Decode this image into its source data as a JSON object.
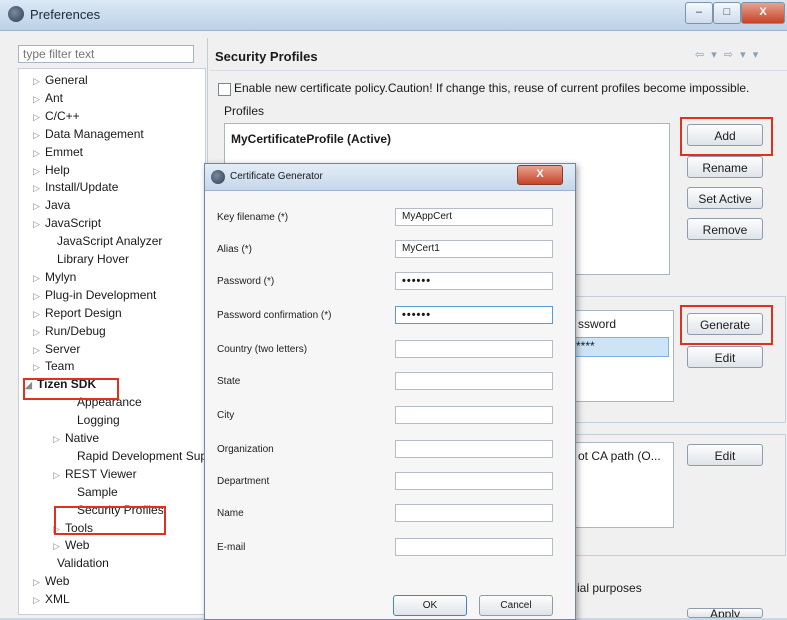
{
  "window": {
    "title": "Preferences",
    "min_label": "–",
    "max_label": "□",
    "close_label": "X"
  },
  "filter": {
    "placeholder": "type filter text"
  },
  "tree": [
    {
      "label": "General",
      "expander": "▷"
    },
    {
      "label": "Ant",
      "expander": "▷"
    },
    {
      "label": "C/C++",
      "expander": "▷"
    },
    {
      "label": "Data Management",
      "expander": "▷"
    },
    {
      "label": "Emmet",
      "expander": "▷"
    },
    {
      "label": "Help",
      "expander": "▷"
    },
    {
      "label": "Install/Update",
      "expander": "▷"
    },
    {
      "label": "Java",
      "expander": "▷"
    },
    {
      "label": "JavaScript",
      "expander": "▷"
    },
    {
      "label": "JavaScript Analyzer",
      "expander": ""
    },
    {
      "label": "Library Hover",
      "expander": ""
    },
    {
      "label": "Mylyn",
      "expander": "▷"
    },
    {
      "label": "Plug-in Development",
      "expander": "▷"
    },
    {
      "label": "Report Design",
      "expander": "▷"
    },
    {
      "label": "Run/Debug",
      "expander": "▷"
    },
    {
      "label": "Server",
      "expander": "▷"
    },
    {
      "label": "Team",
      "expander": "▷"
    },
    {
      "label": "Tizen SDK",
      "expander": "◢"
    },
    {
      "label": "Appearance",
      "expander": ""
    },
    {
      "label": "Logging",
      "expander": ""
    },
    {
      "label": "Native",
      "expander": "▷"
    },
    {
      "label": "Rapid Development Sup",
      "expander": ""
    },
    {
      "label": "REST Viewer",
      "expander": "▷"
    },
    {
      "label": "Sample",
      "expander": ""
    },
    {
      "label": "Security Profiles",
      "expander": ""
    },
    {
      "label": "Tools",
      "expander": "▷"
    },
    {
      "label": "Web",
      "expander": "▷"
    },
    {
      "label": "Validation",
      "expander": ""
    },
    {
      "label": "Web",
      "expander": "▷"
    },
    {
      "label": "XML",
      "expander": "▷"
    }
  ],
  "main": {
    "title": "Security Profiles",
    "nav_arrows": "⇦ ▾ ⇨ ▾ ▾",
    "policy_checkbox_label": "Enable new certificate policy.Caution! If change this, reuse of current profiles become impossible.",
    "profiles_label": "Profiles",
    "active_profile": "MyCertificateProfile (Active)",
    "buttons": {
      "add": "Add",
      "rename": "Rename",
      "set_active": "Set Active",
      "remove": "Remove",
      "generate": "Generate",
      "edit": "Edit",
      "edit2": "Edit",
      "apply": "Apply"
    },
    "author_table_header": "ssword",
    "author_row_value": "****",
    "distributor_table_header": "ot CA path (O...",
    "commercial_text": "ial purposes"
  },
  "dialog": {
    "title": "Certificate Generator",
    "close_label": "X",
    "fields": [
      {
        "label": "Key filename (*)",
        "value": "MyAppCert"
      },
      {
        "label": "Alias (*)",
        "value": "MyCert1"
      },
      {
        "label": "Password (*)",
        "value": "••••••"
      },
      {
        "label": "Password confirmation (*)",
        "value": "••••••"
      },
      {
        "label": "Country (two letters)",
        "value": ""
      },
      {
        "label": "State",
        "value": ""
      },
      {
        "label": "City",
        "value": ""
      },
      {
        "label": "Organization",
        "value": ""
      },
      {
        "label": "Department",
        "value": ""
      },
      {
        "label": "Name",
        "value": ""
      },
      {
        "label": "E-mail",
        "value": ""
      }
    ],
    "ok_label": "OK",
    "cancel_label": "Cancel"
  }
}
